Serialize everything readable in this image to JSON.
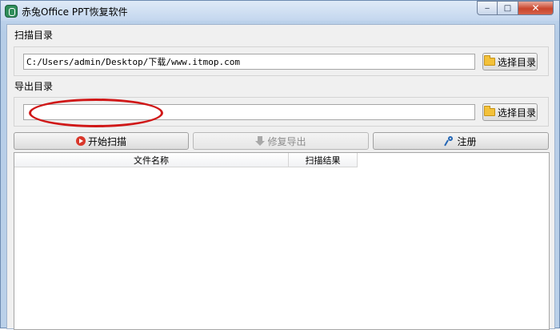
{
  "window": {
    "title": "赤兔Office PPT恢复软件",
    "min_symbol": "‒",
    "max_symbol": "□",
    "close_symbol": "✕"
  },
  "scan": {
    "label": "扫描目录",
    "path": "C:/Users/admin/Desktop/下载/www.itmop.com",
    "browse_label": "选择目录"
  },
  "export": {
    "label": "导出目录",
    "path": "",
    "browse_label": "选择目录"
  },
  "actions": {
    "start_scan": "开始扫描",
    "repair_export": "修复导出",
    "register": "注册"
  },
  "table": {
    "columns": [
      "文件名称",
      "扫描结果"
    ]
  },
  "colors": {
    "highlight_ring": "#d01818"
  }
}
